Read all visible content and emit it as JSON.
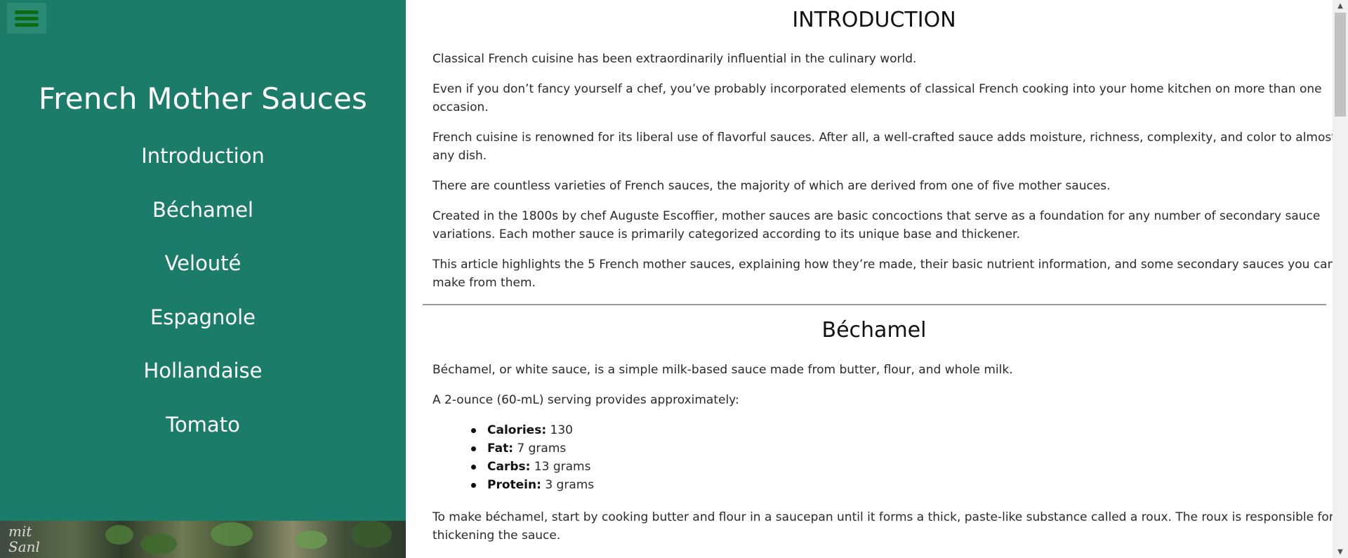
{
  "sidebar": {
    "menu_icon": "hamburger-menu-icon",
    "title": "French Mother Sauces",
    "nav": [
      {
        "label": "Introduction"
      },
      {
        "label": "Béchamel"
      },
      {
        "label": "Velouté"
      },
      {
        "label": "Espagnole"
      },
      {
        "label": "Hollandaise"
      },
      {
        "label": "Tomato"
      }
    ],
    "photo_chalk_text": "mit\nSanl",
    "bg_color": "#1c7c6a"
  },
  "main": {
    "intro": {
      "title": "INTRODUCTION",
      "paragraphs": [
        "Classical French cuisine has been extraordinarily influential in the culinary world.",
        "Even if you don’t fancy yourself a chef, you’ve probably incorporated elements of classical French cooking into your home kitchen on more than one occasion.",
        "French cuisine is renowned for its liberal use of flavorful sauces. After all, a well-crafted sauce adds moisture, richness, complexity, and color to almost any dish.",
        "There are countless varieties of French sauces, the majority of which are derived from one of five mother sauces.",
        "Created in the 1800s by chef Auguste Escoffier, mother sauces are basic concoctions that serve as a foundation for any number of secondary sauce variations. Each mother sauce is primarily categorized according to its unique base and thickener.",
        "This article highlights the 5 French mother sauces, explaining how they’re made, their basic nutrient information, and some secondary sauces you can make from them."
      ]
    },
    "bechamel": {
      "title": "Béchamel",
      "p1": "Béchamel, or white sauce, is a simple milk-based sauce made from butter, flour, and whole milk.",
      "p2": "A 2-ounce (60-mL) serving provides approximately:",
      "nutrition": [
        {
          "label": "Calories:",
          "value": "130"
        },
        {
          "label": "Fat:",
          "value": "7 grams"
        },
        {
          "label": "Carbs:",
          "value": "13 grams"
        },
        {
          "label": "Protein:",
          "value": "3 grams"
        }
      ],
      "p3": "To make béchamel, start by cooking butter and flour in a saucepan until it forms a thick, paste-like substance called a roux. The roux is responsible for thickening the sauce."
    }
  },
  "scrollbar": {
    "up_icon": "scroll-up-arrow-icon",
    "down_icon": "scroll-down-arrow-icon"
  }
}
